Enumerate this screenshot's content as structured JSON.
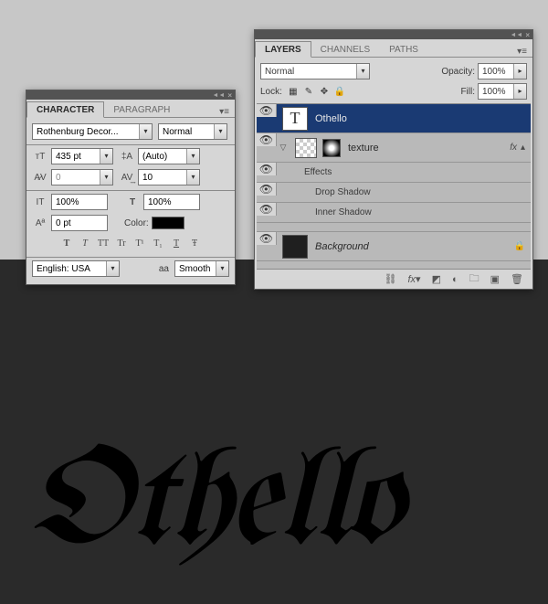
{
  "character_panel": {
    "tabs": [
      "CHARACTER",
      "PARAGRAPH"
    ],
    "font": "Rothenburg Decor...",
    "style": "Normal",
    "size": "435 pt",
    "leading": "(Auto)",
    "kerning": "0",
    "tracking": "10",
    "vscale": "100%",
    "hscale": "100%",
    "baseline": "0 pt",
    "color_label": "Color:",
    "language": "English: USA",
    "aa_label": "aa",
    "aa_value": "Smooth",
    "type_buttons": [
      "T",
      "T",
      "TT",
      "Tr",
      "T¹",
      "T₁",
      "T",
      "Ŧ"
    ]
  },
  "layers_panel": {
    "tabs": [
      "LAYERS",
      "CHANNELS",
      "PATHS"
    ],
    "blend": "Normal",
    "opacity_label": "Opacity:",
    "opacity": "100%",
    "lock_label": "Lock:",
    "fill_label": "Fill:",
    "fill": "100%",
    "layers": [
      {
        "name": "Othello",
        "selected": true,
        "type": "text"
      },
      {
        "name": "texture",
        "type": "raster",
        "fx": true,
        "effects_label": "Effects",
        "effects": [
          "Drop Shadow",
          "Inner Shadow"
        ]
      },
      {
        "name": "Background",
        "type": "bg",
        "locked": true
      }
    ]
  },
  "canvas_text": "Othello"
}
